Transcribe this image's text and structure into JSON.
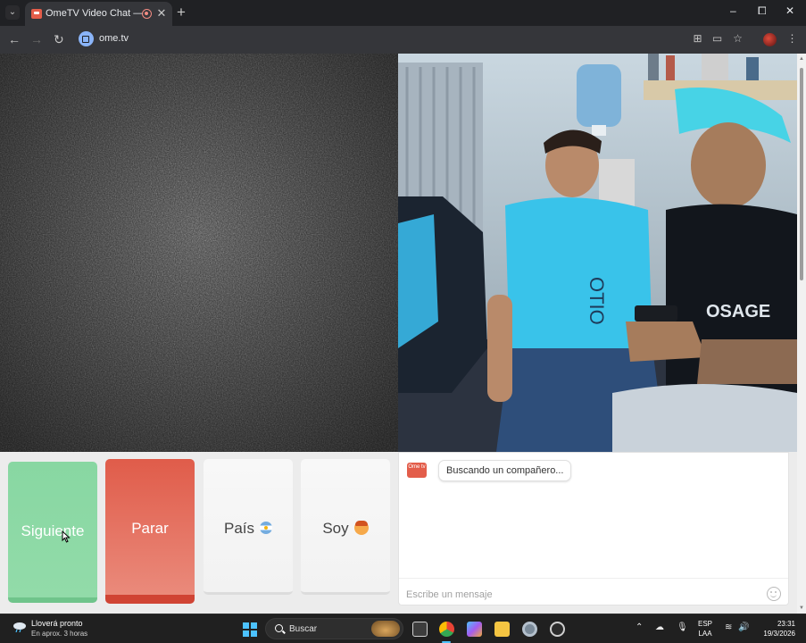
{
  "browser": {
    "tab_title": "OmeTV Video Chat — Omegle",
    "new_tab": "+",
    "url": "ome.tv",
    "window_controls": {
      "minimize": "–",
      "maximize": "⧠",
      "close": "✕"
    }
  },
  "controls": {
    "next_label": "Siguiente",
    "stop_label": "Parar",
    "country_label": "País",
    "gender_label": "Soy"
  },
  "chat": {
    "logo_text": "Ome tv",
    "status_message": "Buscando un compañero...",
    "input_placeholder": "Escribe un mensaje"
  },
  "taskbar": {
    "weather_title": "Lloverá pronto",
    "weather_sub": "En aprox. 3 horas",
    "search_label": "Buscar",
    "language": "ESP",
    "layout": "LAA",
    "time": "23:31",
    "date": "19/3/2026"
  },
  "colors": {
    "next_button": "#88d7a2",
    "stop_button": "#e05c4a",
    "accent": "#4cc2ff",
    "brand_red": "#e35d4a"
  },
  "icons": {
    "country_flag": "argentina-flag-icon",
    "gender": "boy-face-icon"
  }
}
